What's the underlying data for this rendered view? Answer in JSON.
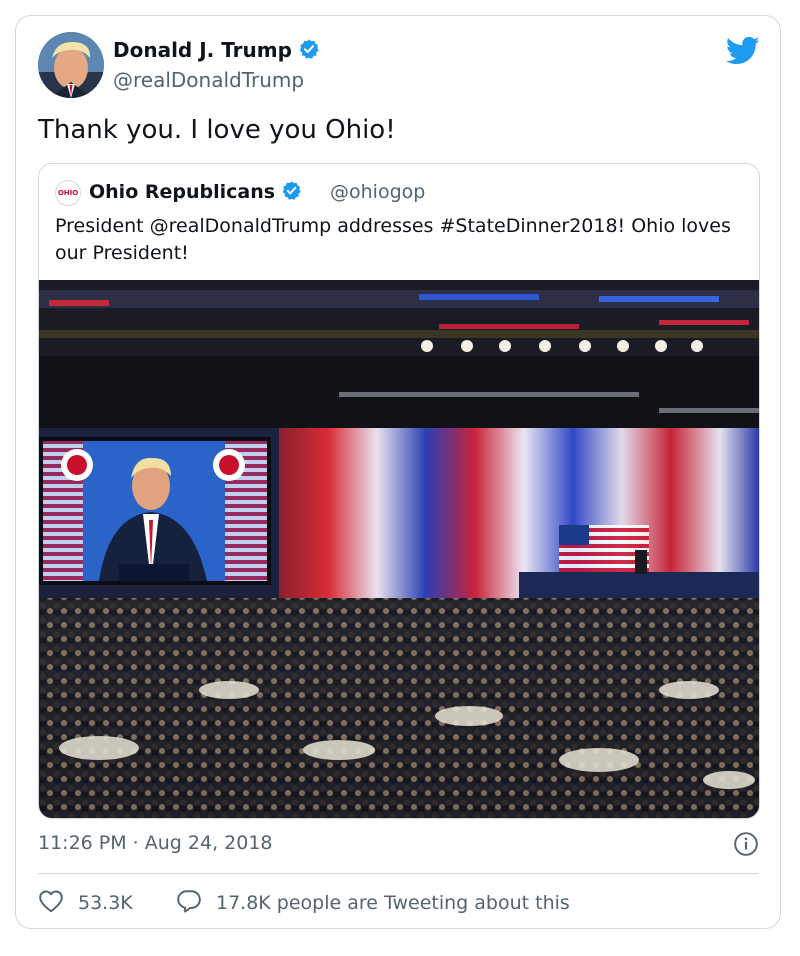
{
  "tweet": {
    "author": {
      "name": "Donald J. Trump",
      "handle": "@realDonaldTrump",
      "verified": true
    },
    "text": "Thank you. I love you Ohio!",
    "timestamp": "11:26 PM · Aug 24, 2018",
    "likes_count": "53.3K",
    "discussion_label": "17.8K people are Tweeting about this"
  },
  "quoted_tweet": {
    "author": {
      "name": "Ohio Republicans",
      "handle": "@ohiogop",
      "verified": true,
      "logo_text": "OHIO"
    },
    "text": "President @realDonaldTrump addresses #StateDinner2018! Ohio loves our President!"
  },
  "icons": {
    "brand": "twitter-bird-icon",
    "verified": "verified-badge-icon",
    "info": "info-icon",
    "like": "heart-icon",
    "reply": "speech-bubble-icon"
  },
  "colors": {
    "brand": "#1d9bf0",
    "text": "#0f1419",
    "secondary_text": "#536471",
    "border": "#cfd9de"
  }
}
